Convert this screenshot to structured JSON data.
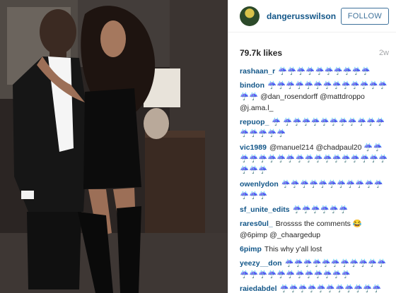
{
  "post": {
    "username": "dangerusswilson",
    "follow_label": "FOLLOW",
    "likes": "79.7k likes",
    "time": "2w"
  },
  "comments": [
    {
      "author": "rashaan_r",
      "text": "☔☔☔☔☔☔☔☔☔☔"
    },
    {
      "author": "bindon",
      "text": "☔☔☔☔☔☔☔☔☔☔☔☔☔☔☔ @dan_rosendorff @mattdroppo @j.ama.l_"
    },
    {
      "author": "repuop_",
      "text": "☔ ☔☔☔☔☔☔☔☔☔☔☔☔☔☔☔☔"
    },
    {
      "author": "vic1989",
      "text": "@manuel214 @chadpaul20 ☔☔☔☔☔☔☔☔☔☔☔☔☔☔☔☔☔☔☔☔☔"
    },
    {
      "author": "owenlydon",
      "text": "☔☔☔☔☔☔☔☔☔☔☔☔☔☔"
    },
    {
      "author": "sf_unite_edits",
      "text": "☔☔☔☔☔☔"
    },
    {
      "author": "rares0ul_",
      "text": "Brossss the comments 😂 @6pimp @_chaargedup"
    },
    {
      "author": "6pimp",
      "text": "This why y'all lost"
    },
    {
      "author": "yeezy__don",
      "text": "☔☔☔☔☔☔☔☔☔☔☔☔☔☔☔☔☔☔☔☔☔☔☔"
    },
    {
      "author": "raiedabdel",
      "text": "☔☔☔☔☔☔☔☔☔☔☔☔"
    }
  ],
  "icons": {
    "avatar": "profile-avatar-icon",
    "emoji_umbrella": "umbrella-rain-emoji",
    "emoji_laugh": "tears-of-joy-emoji"
  },
  "colors": {
    "link": "#125688",
    "follow": "#3f729b",
    "text": "#262626",
    "muted": "#a5a7aa"
  }
}
